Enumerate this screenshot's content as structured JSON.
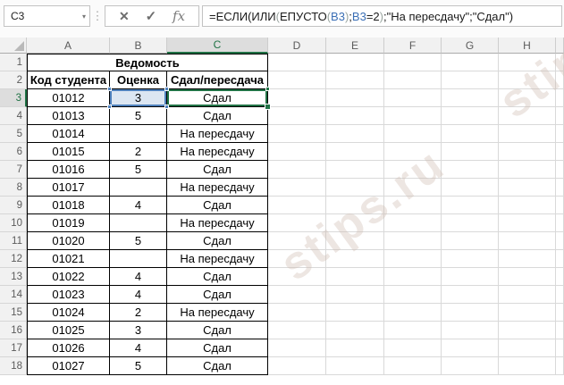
{
  "formula_bar": {
    "name_box_value": "C3",
    "name_box_dropdown_icon": "▾",
    "separator_icon": "⋮",
    "cancel_icon": "✕",
    "enter_icon": "✓",
    "insert_function_label": "fx",
    "formula_full": "=ЕСЛИ(ИЛИ(ЕПУСТО(B3);B3=2);\"На пересдачу\";\"Сдал\")",
    "formula_parts": [
      {
        "t": "=ЕСЛИ(ИЛИ",
        "c": "k"
      },
      {
        "t": "(",
        "c": "p"
      },
      {
        "t": "ЕПУСТО",
        "c": "k"
      },
      {
        "t": "(",
        "c": "p"
      },
      {
        "t": "B3",
        "c": "b"
      },
      {
        "t": ")",
        "c": "p"
      },
      {
        "t": ";",
        "c": "k"
      },
      {
        "t": "B3",
        "c": "b"
      },
      {
        "t": "=2",
        "c": "k"
      },
      {
        "t": ")",
        "c": "p"
      },
      {
        "t": ";\"На пересдачу\";\"Сдал\")",
        "c": "k"
      }
    ]
  },
  "grid": {
    "column_headers": [
      "A",
      "B",
      "C",
      "D",
      "E",
      "F",
      "G",
      "H"
    ],
    "row_headers": [
      "1",
      "2",
      "3",
      "4",
      "5",
      "6",
      "7",
      "8",
      "9",
      "10",
      "11",
      "12",
      "13",
      "14",
      "15",
      "16",
      "17",
      "18"
    ],
    "selected_column": "C",
    "selected_row": "3",
    "active_cell": "C3",
    "referenced_cell": "B3"
  },
  "table": {
    "title": "Ведомость",
    "headers": [
      "Код студента",
      "Оценка",
      "Сдал/пересдача"
    ],
    "rows": [
      [
        "01012",
        "3",
        "Сдал"
      ],
      [
        "01013",
        "5",
        "Сдал"
      ],
      [
        "01014",
        "",
        "На пересдачу"
      ],
      [
        "01015",
        "2",
        "На пересдачу"
      ],
      [
        "01016",
        "5",
        "Сдал"
      ],
      [
        "01017",
        "",
        "На пересдачу"
      ],
      [
        "01018",
        "4",
        "Сдал"
      ],
      [
        "01019",
        "",
        "На пересдачу"
      ],
      [
        "01020",
        "5",
        "Сдал"
      ],
      [
        "01021",
        "",
        "На пересдачу"
      ],
      [
        "01022",
        "4",
        "Сдал"
      ],
      [
        "01023",
        "4",
        "Сдал"
      ],
      [
        "01024",
        "2",
        "На пересдачу"
      ],
      [
        "01025",
        "3",
        "Сдал"
      ],
      [
        "01026",
        "4",
        "Сдал"
      ],
      [
        "01027",
        "5",
        "Сдал"
      ]
    ]
  },
  "colors": {
    "selection_green": "#217346",
    "reference_blue": "#4f81bd",
    "reference_fill": "#dce6f2",
    "table_border": "#000000",
    "gridline": "#d9d9d9",
    "header_bg": "#f1f1f1",
    "header_selected_bg": "#dddddd"
  },
  "watermark": "stips.ru"
}
